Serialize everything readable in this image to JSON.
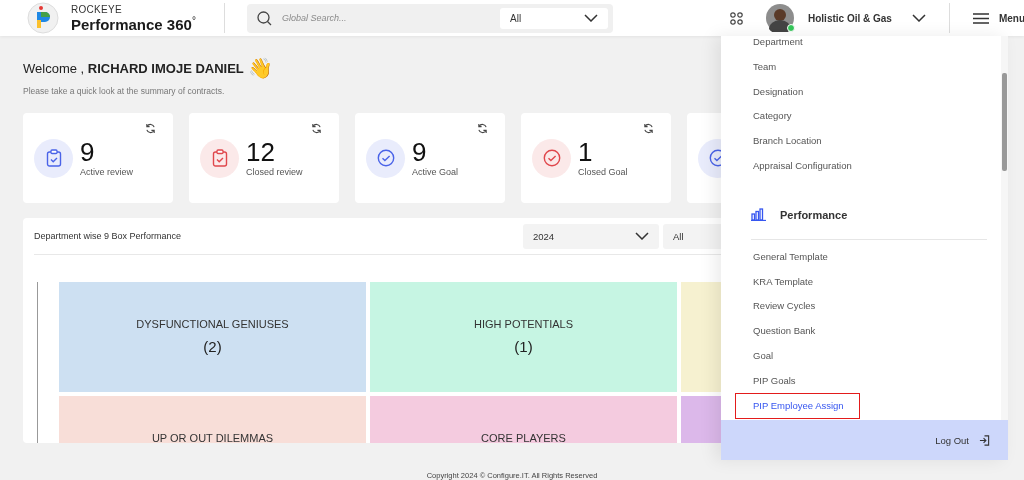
{
  "header": {
    "brand_top": "ROCKEYE",
    "brand": "Performance 360",
    "brand_mark": "°",
    "search": {
      "placeholder": "Global Search..."
    },
    "scope": "All",
    "company": "Holistic Oil & Gas",
    "menu_label": "Menu"
  },
  "welcome": {
    "greeting": "Welcome ,",
    "name": "RICHARD IMOJE DANIEL",
    "wave": "👋",
    "subtitle": "Please take a quick look at the summary of contracts."
  },
  "stats": [
    {
      "kind": "review",
      "color": "#4a63e8",
      "value": "9",
      "label": "Active review"
    },
    {
      "kind": "review",
      "color": "#e0474c",
      "value": "12",
      "label": "Closed review"
    },
    {
      "kind": "goal",
      "color": "#4a63e8",
      "value": "9",
      "label": "Active Goal"
    },
    {
      "kind": "goal",
      "color": "#e0474c",
      "value": "1",
      "label": "Closed Goal"
    },
    {
      "kind": "goal",
      "color": "#4a63e8"
    }
  ],
  "nine_box": {
    "title": "Department wise 9 Box Performance",
    "year": "2024",
    "filter": "All",
    "cells": [
      {
        "label": "DYSFUNCTIONAL GENIUSES",
        "count": "(2)",
        "color": "#cde0f2"
      },
      {
        "label": "HIGH POTENTIALS",
        "count": "(1)",
        "color": "#c6f5e3"
      },
      {
        "color": "#f6f1d0"
      },
      {
        "label": "UP OR OUT DILEMMAS",
        "color": "#f8ded8"
      },
      {
        "label": "CORE PLAYERS",
        "color": "#f4cbdf"
      },
      {
        "color": "#dcb8ea"
      }
    ]
  },
  "footer": "Copyright 2024 © Configure.IT. All Rights Reserved",
  "menu": {
    "items": [
      {
        "label": "Department",
        "selected": false
      },
      {
        "label": "Team",
        "selected": false
      },
      {
        "label": "Designation",
        "selected": false
      },
      {
        "label": "Category",
        "selected": false
      },
      {
        "label": "Branch Location",
        "selected": false
      },
      {
        "label": "Appraisal Configuration",
        "selected": false
      }
    ],
    "section": {
      "title": "Performance",
      "items": [
        {
          "label": "General Template",
          "selected": false
        },
        {
          "label": "KRA Template",
          "selected": false
        },
        {
          "label": "Review Cycles",
          "selected": false
        },
        {
          "label": "Question Bank",
          "selected": false
        },
        {
          "label": "Goal",
          "selected": false
        },
        {
          "label": "PIP Goals",
          "selected": false
        },
        {
          "label": "PIP Employee Assign",
          "selected": true
        }
      ]
    },
    "logout": "Log Out"
  }
}
